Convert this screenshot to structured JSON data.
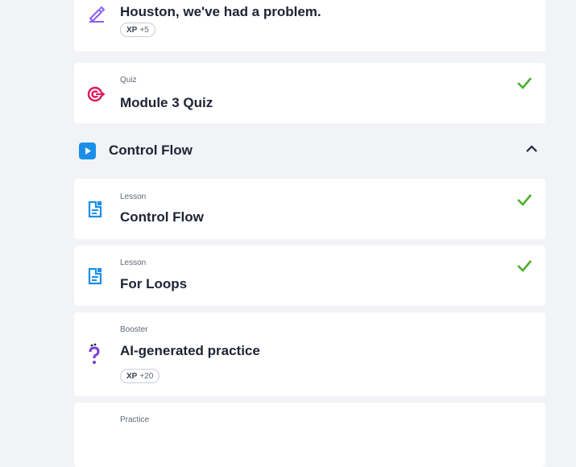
{
  "items": [
    {
      "type": "",
      "title": "Houston, we've had a problem.",
      "xp_label": "XP",
      "xp_value": "+5",
      "completed": false,
      "icon": "pencil-icon"
    },
    {
      "type": "Quiz",
      "title": "Module 3 Quiz",
      "completed": true,
      "icon": "target-icon"
    },
    {
      "type": "Lesson",
      "title": "Control Flow",
      "completed": true,
      "icon": "lesson-doc-icon"
    },
    {
      "type": "Lesson",
      "title": "For Loops",
      "completed": true,
      "icon": "lesson-doc-icon"
    },
    {
      "type": "Booster",
      "title": "AI-generated practice",
      "xp_label": "XP",
      "xp_value": "+20",
      "completed": false,
      "icon": "booster-question-icon"
    },
    {
      "type": "Practice",
      "title": "",
      "completed": false,
      "icon": ""
    }
  ],
  "section": {
    "title": "Control Flow",
    "expanded": true
  },
  "colors": {
    "accent_blue": "#1a8fe8",
    "check_green": "#4caf2f",
    "quiz_pink": "#e0185a",
    "booster_purple": "#7a3fd6"
  }
}
